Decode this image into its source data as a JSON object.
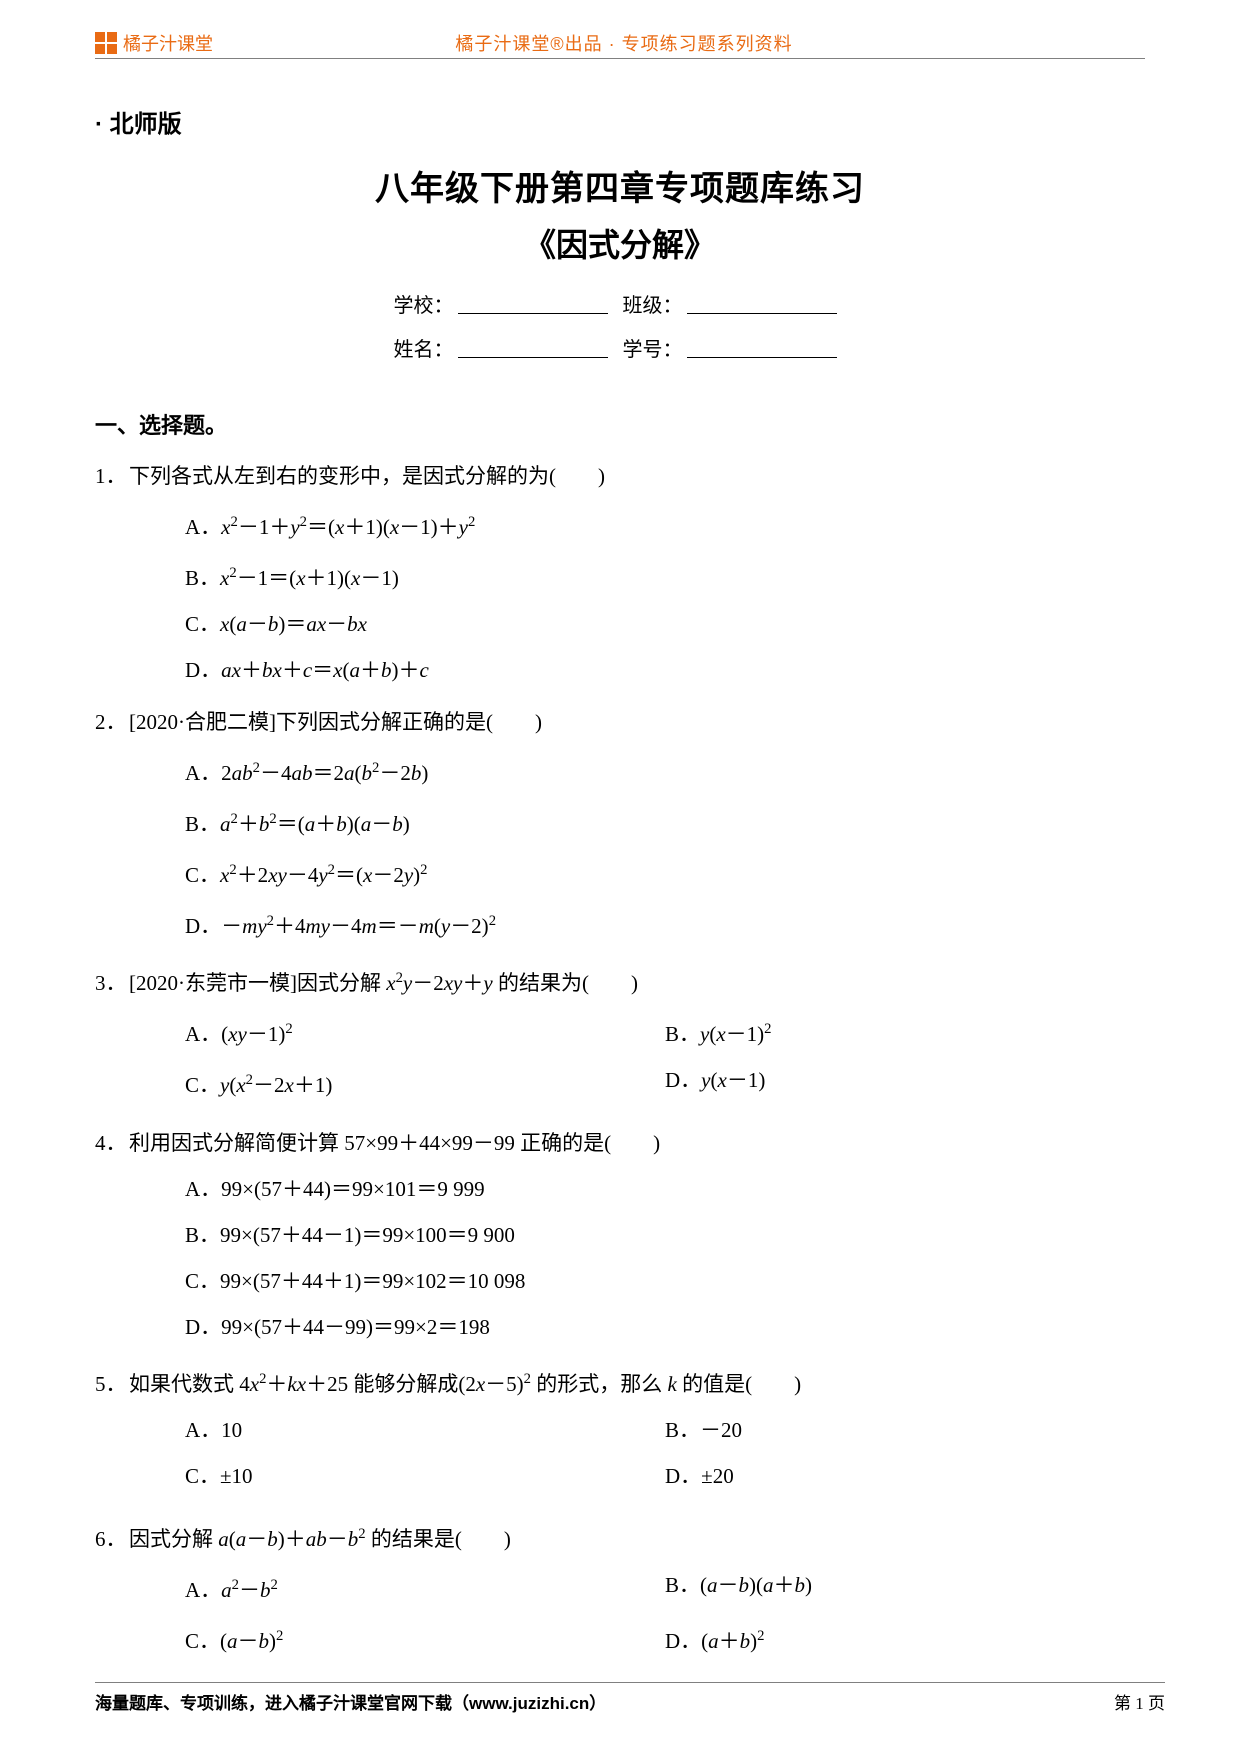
{
  "header": {
    "brand": "橘子汁课堂",
    "center": "橘子汁课堂®出品 · 专项练习题系列资料"
  },
  "edition": "· 北师版",
  "title1": "八年级下册第四章专项题库练习",
  "title2": "《因式分解》",
  "info": {
    "school_label": "学校：",
    "class_label": "班级：",
    "name_label": "姓名：",
    "id_label": "学号："
  },
  "section1": "一、选择题。",
  "q1": {
    "num": "1．",
    "stem": "下列各式从左到右的变形中，是因式分解的为(　　)",
    "A": "A．x²－1＋y²＝(x＋1)(x－1)＋y²",
    "B": "B．x²－1＝(x＋1)(x－1)",
    "C": "C．x(a－b)＝ax－bx",
    "D": "D．ax＋bx＋c＝x(a＋b)＋c"
  },
  "q2": {
    "num": "2．",
    "stem": "[2020·合肥二模]下列因式分解正确的是(　　)",
    "A": "A．2ab²－4ab＝2a(b²－2b)",
    "B": "B．a²＋b²＝(a＋b)(a－b)",
    "C": "C．x²＋2xy－4y²＝(x－2y)²",
    "D": "D．－my²＋4my－4m＝－m(y－2)²"
  },
  "q3": {
    "num": "3．",
    "stem": "[2020·东莞市一模]因式分解 x²y－2xy＋y 的结果为(　　)",
    "A": "A．(xy－1)²",
    "B": "B．y(x－1)²",
    "C": "C．y(x²－2x＋1)",
    "D": "D．y(x－1)"
  },
  "q4": {
    "num": "4．",
    "stem": "利用因式分解简便计算 57×99＋44×99－99 正确的是(　　)",
    "A": "A．99×(57＋44)＝99×101＝9 999",
    "B": "B．99×(57＋44－1)＝99×100＝9 900",
    "C": "C．99×(57＋44＋1)＝99×102＝10 098",
    "D": "D．99×(57＋44－99)＝99×2＝198"
  },
  "q5": {
    "num": "5．",
    "stem": "如果代数式 4x²＋kx＋25 能够分解成(2x－5)² 的形式，那么 k 的值是(　　)",
    "A": "A．10",
    "B": "B．－20",
    "C": "C．±10",
    "D": "D．±20"
  },
  "q6": {
    "num": "6．",
    "stem": "因式分解 a(a－b)＋ab－b² 的结果是(　　)",
    "A": "A．a²－b²",
    "B": "B．(a－b)(a＋b)",
    "C": "C．(a－b)²",
    "D": "D．(a＋b)²"
  },
  "footer": {
    "left": "海量题库、专项训练，进入橘子汁课堂官网下载（www.juzizhi.cn）",
    "right": "第 1 页"
  }
}
